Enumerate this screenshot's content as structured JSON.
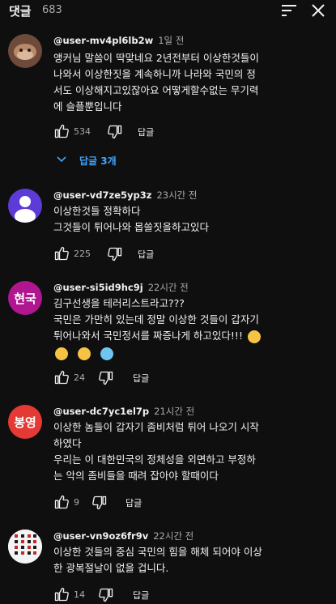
{
  "header": {
    "title": "댓글",
    "count": "683"
  },
  "comments": [
    {
      "user": "@user-mv4pl6lb2w",
      "time": "1일 전",
      "lines": [
        "앵커님 말씀이 딱맞네요  2년전부터 이상한것들이",
        "나와서 이상한짓을 계속하니까 나라와 국민의 정",
        "서도 이상해지고있잖아요  어떻게할수없는 무기력",
        "에 슬플뿐입니다"
      ],
      "likes": "534",
      "reply_label": "답글",
      "replies_label": "답글 3개"
    },
    {
      "user": "@user-vd7ze5yp3z",
      "time": "23시간 전",
      "lines": [
        "이상한것들 정확하다",
        "그것들이 튀어나와 몹쓸짓을하고있다"
      ],
      "likes": "225",
      "reply_label": "답글"
    },
    {
      "user": "@user-si5id9hc9j",
      "time": "22시간 전",
      "avatar_text": "현국",
      "lines": [
        "김구선생을 테러리스트라고???",
        "국민은 가만히 있는데 정말 이상한 것들이 갑자기",
        "튀어나와서 국민정서를 짜증나게 하고있다!!!"
      ],
      "emojis": [
        "confused-face",
        "slightly-smiling-face",
        "cold-face"
      ],
      "likes": "24",
      "reply_label": "답글"
    },
    {
      "user": "@user-dc7yc1el7p",
      "time": "21시간 전",
      "avatar_text": "봉영",
      "lines": [
        "이상한 놈들이 갑자기 좀비처럼 튀어 나오기 시작",
        "하였다",
        "우리는 이 대한민국의 정체성을 외면하고 부정하",
        "는 악의 좀비들을 때려 잡아야 할때이다"
      ],
      "likes": "9",
      "reply_label": "답글"
    },
    {
      "user": "@user-vn9oz6fr9v",
      "time": "22시간 전",
      "lines": [
        "이상한 것들의 중심 국민의 힘을 해체 되어야 이상",
        "한 광복절날이 없을 겁니다."
      ],
      "likes": "14",
      "reply_label": "답글"
    }
  ],
  "colors": {
    "background": "#0f0f0f",
    "text_primary": "#f1f1f1",
    "text_secondary": "#aaaaaa",
    "link_blue": "#3ea6ff",
    "avatar_purple": "#5c3bd6",
    "avatar_magenta": "#b0168f",
    "avatar_red": "#e53935"
  },
  "icons": {
    "sort": "sort-icon",
    "close": "close-icon",
    "like": "thumb-up-icon",
    "dislike": "thumb-down-icon",
    "expand": "chevron-down-icon"
  }
}
